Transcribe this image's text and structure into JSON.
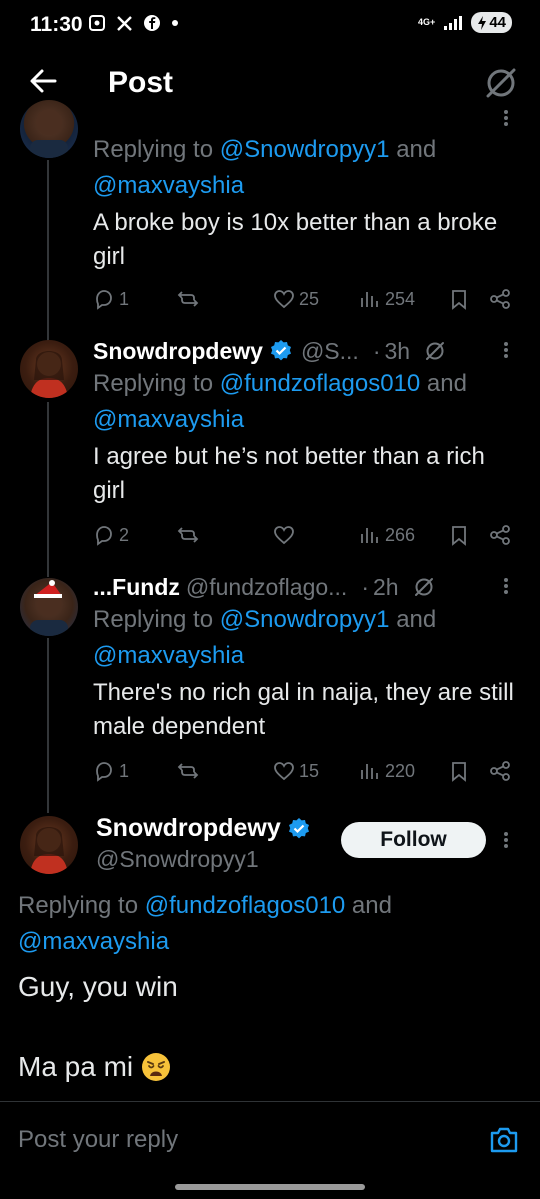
{
  "status_bar": {
    "time": "11:30",
    "network": "4G+",
    "battery": "44"
  },
  "header": {
    "title": "Post"
  },
  "tweets": [
    {
      "replying_prefix": "Replying to ",
      "mention1": "@Snowdropyy1",
      "and": " and",
      "mention2": "@maxvayshia",
      "text": "A broke boy is 10x better than a broke girl",
      "replies": "1",
      "likes": "25",
      "views": "254"
    },
    {
      "name": "Snowdropdewy",
      "handle": "@S...",
      "time": "3h",
      "replying_prefix": "Replying to ",
      "mention1": "@fundzoflagos010",
      "and": " and",
      "mention2": "@maxvayshia",
      "text": "I agree but he’s not better than a rich girl",
      "replies": "2",
      "likes": "",
      "views": "266"
    },
    {
      "name": "...Fundz",
      "handle": "@fundzoflago...",
      "time": "2h",
      "replying_prefix": "Replying to ",
      "mention1": "@Snowdropyy1",
      "and": " and",
      "mention2": "@maxvayshia",
      "text": "There's no rich gal in naija, they are still male dependent",
      "replies": "1",
      "likes": "15",
      "views": "220"
    }
  ],
  "main_tweet": {
    "name": "Snowdropdewy",
    "handle": "@Snowdropyy1",
    "follow_label": "Follow",
    "replying_prefix": "Replying to ",
    "mention1": "@fundzoflagos010",
    "and": " and",
    "mention2": "@maxvayshia",
    "text_line1": "Guy, you win",
    "text_line2": "Ma pa mi"
  },
  "reply_bar": {
    "placeholder": "Post your reply"
  },
  "colors": {
    "background": "#000000",
    "accent": "#1d9bf0",
    "muted": "#71767b"
  }
}
